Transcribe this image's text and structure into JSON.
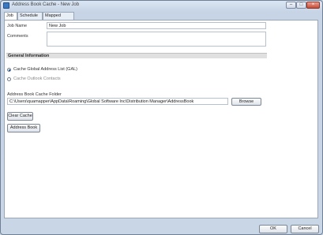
{
  "window": {
    "title": "Address Book Cache - New Job"
  },
  "window_controls": {
    "minimize": "‒",
    "maximize": "□",
    "close": "×"
  },
  "tabs": [
    {
      "label": "Job",
      "active": true
    },
    {
      "label": "Schedule",
      "active": false
    },
    {
      "label": "Mapped Drives",
      "active": false
    }
  ],
  "job": {
    "name_label": "Job Name",
    "name_value": "New Job",
    "comments_label": "Comments",
    "comments_value": ""
  },
  "general": {
    "header": "General Information",
    "option_gal": "Cache Global Address List (GAL)",
    "option_gal_checked": true,
    "option_outlook": "Cache Outlook Contacts",
    "option_outlook_checked": false
  },
  "cache_folder": {
    "label": "Address Book Cache Folder",
    "value": "C:\\Users\\quamapper\\AppData\\Roaming\\Global Software Inc\\Distribution Manager\\AddressBook",
    "browse_label": "Browse"
  },
  "actions": {
    "clear_cache": "Clear Cache",
    "address_book": "Address Book"
  },
  "footer": {
    "ok": "OK",
    "cancel": "Cancel"
  }
}
